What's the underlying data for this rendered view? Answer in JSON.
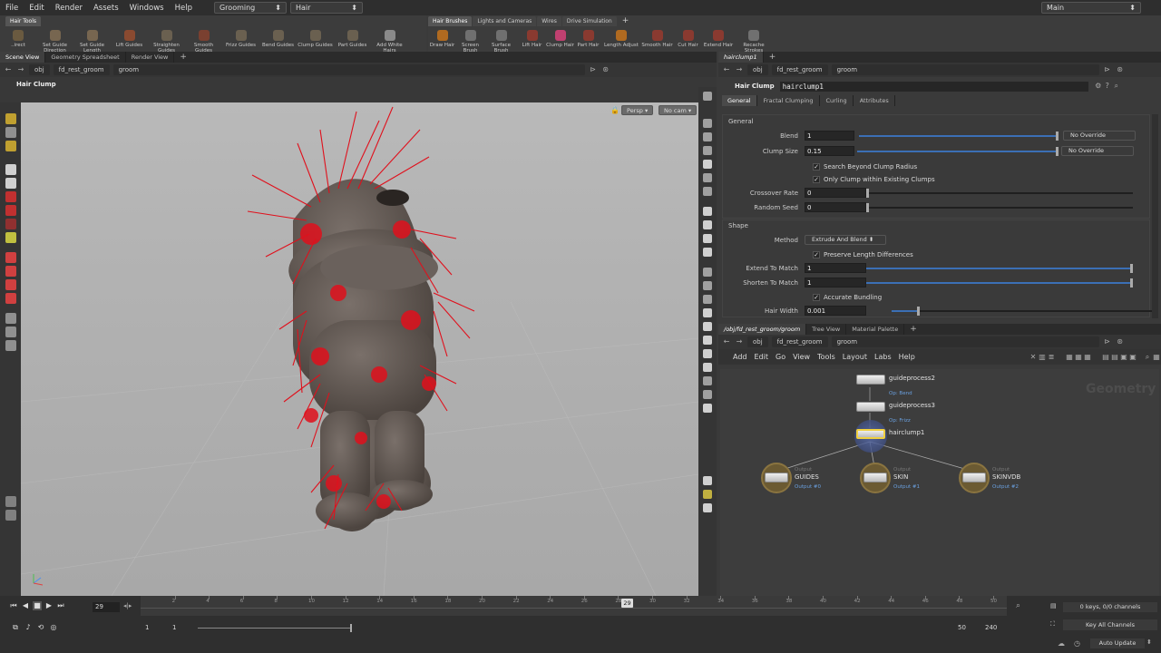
{
  "menu": [
    "File",
    "Edit",
    "Render",
    "Assets",
    "Windows",
    "Help"
  ],
  "desktop": "Grooming",
  "context": "Hair",
  "workspace": "Main",
  "shelf_left": {
    "tabs": [
      "Hair Tools"
    ],
    "tools": [
      "Set Guide Direction",
      "Set Guide Length",
      "Lift Guides",
      "Straighten Guides",
      "Smooth Guides",
      "Frizz Guides",
      "Bend Guides",
      "Clump Guides",
      "Part Guides",
      "Add White Hairs"
    ],
    "first_tool": "..irect"
  },
  "shelf_right": {
    "tabs": [
      "Hair Brushes",
      "Lights and Cameras",
      "Wires",
      "Drive Simulation"
    ],
    "tools": [
      "Draw Hair",
      "Screen Brush",
      "Surface Brush",
      "Lift Hair",
      "Clump Hair",
      "Part Hair",
      "Length Adjust",
      "Smooth Hair",
      "Cut Hair",
      "Extend Hair",
      "Recache Strokes"
    ]
  },
  "viewer": {
    "tabs": [
      "Scene View",
      "Geometry Spreadsheet",
      "Render View"
    ],
    "path": [
      "obj",
      "fd_rest_groom",
      "groom"
    ],
    "state": "Hair Clump",
    "persp": "Persp",
    "cam": "No cam"
  },
  "params": {
    "pane_tab": "hairclump1",
    "path": [
      "obj",
      "fd_rest_groom",
      "groom"
    ],
    "node_type": "Hair Clump",
    "node_name": "hairclump1",
    "tabs": [
      "General",
      "Fractal Clumping",
      "Curling",
      "Attributes"
    ],
    "section_general": "General",
    "section_shape": "Shape",
    "blend_label": "Blend",
    "blend_value": "1",
    "blend_override": "No Override",
    "clumpsize_label": "Clump Size",
    "clumpsize_value": "0.15",
    "clumpsize_override": "No Override",
    "search_beyond": "Search Beyond Clump Radius",
    "only_clump": "Only Clump within Existing Clumps",
    "crossover_label": "Crossover Rate",
    "crossover_value": "0",
    "seed_label": "Random Seed",
    "seed_value": "0",
    "method_label": "Method",
    "method_value": "Extrude And Blend",
    "preserve": "Preserve Length Differences",
    "extend_label": "Extend To Match",
    "extend_value": "1",
    "shorten_label": "Shorten To Match",
    "shorten_value": "1",
    "accurate": "Accurate Bundling",
    "width_label": "Hair Width",
    "width_value": "0.001"
  },
  "network": {
    "tabs": [
      "/obj/fd_rest_groom/groom",
      "Tree View",
      "Material Palette"
    ],
    "path": [
      "obj",
      "fd_rest_groom",
      "groom"
    ],
    "menu": [
      "Add",
      "Edit",
      "Go",
      "View",
      "Tools",
      "Layout",
      "Labs",
      "Help"
    ],
    "watermark": "Geometry",
    "nodes": [
      {
        "name": "guideprocess2",
        "sub": "Op: Bend"
      },
      {
        "name": "guideprocess3",
        "sub": "Op: Frizz"
      },
      {
        "name": "hairclump1",
        "sub": ""
      }
    ],
    "outputs": [
      {
        "name": "GUIDES",
        "sub": "Output #0",
        "tag": "Output"
      },
      {
        "name": "SKIN",
        "sub": "Output #1",
        "tag": "Output"
      },
      {
        "name": "SKINVDB",
        "sub": "Output #2",
        "tag": "Output"
      }
    ]
  },
  "timeline": {
    "current_frame": "29",
    "start": "1",
    "start2": "1",
    "end": "50",
    "end2": "240",
    "ticks": [
      "2",
      "4",
      "6",
      "8",
      "10",
      "12",
      "14",
      "16",
      "18",
      "20",
      "22",
      "24",
      "26",
      "28",
      "30",
      "32",
      "34",
      "36",
      "38",
      "40",
      "42",
      "44",
      "46",
      "48",
      "50"
    ],
    "keys": "0 keys, 0/0 channels",
    "key_all": "Key All Channels",
    "auto_update": "Auto Update"
  },
  "colors": {
    "accent": "#3b6fb5",
    "hair": "#e0101c",
    "body": "#5e5650",
    "selected": "#f0d040"
  }
}
